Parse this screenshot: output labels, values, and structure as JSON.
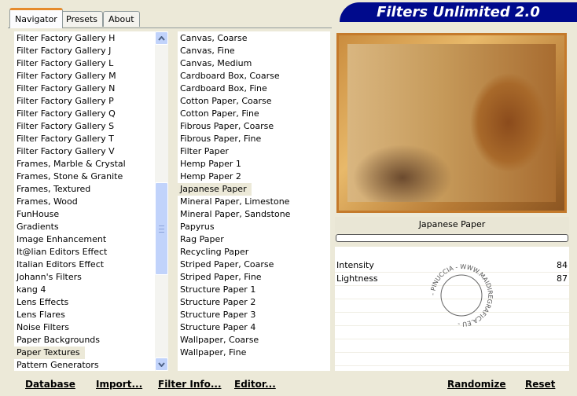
{
  "tabs": [
    "Navigator",
    "Presets",
    "About"
  ],
  "app_title": "Filters Unlimited 2.0",
  "categories": [
    "Filter Factory Gallery H",
    "Filter Factory Gallery J",
    "Filter Factory Gallery L",
    "Filter Factory Gallery M",
    "Filter Factory Gallery N",
    "Filter Factory Gallery P",
    "Filter Factory Gallery Q",
    "Filter Factory Gallery S",
    "Filter Factory Gallery T",
    "Filter Factory Gallery V",
    "Frames, Marble & Crystal",
    "Frames, Stone & Granite",
    "Frames, Textured",
    "Frames, Wood",
    "FunHouse",
    "Gradients",
    "Image Enhancement",
    "It@lian Editors Effect",
    "Italian Editors Effect",
    "Johann's Filters",
    "kang 4",
    "Lens Effects",
    "Lens Flares",
    "Noise Filters",
    "Paper Backgrounds",
    "Paper Textures",
    "Pattern Generators"
  ],
  "selected_category": "Paper Textures",
  "filters": [
    "Canvas, Coarse",
    "Canvas, Fine",
    "Canvas, Medium",
    "Cardboard Box, Coarse",
    "Cardboard Box, Fine",
    "Cotton Paper, Coarse",
    "Cotton Paper, Fine",
    "Fibrous Paper, Coarse",
    "Fibrous Paper, Fine",
    "Filter Paper",
    "Hemp Paper 1",
    "Hemp Paper 2",
    "Japanese Paper",
    "Mineral Paper, Limestone",
    "Mineral Paper, Sandstone",
    "Papyrus",
    "Rag Paper",
    "Recycling Paper",
    "Striped Paper, Coarse",
    "Striped Paper, Fine",
    "Structure Paper 1",
    "Structure Paper 2",
    "Structure Paper 3",
    "Structure Paper 4",
    "Wallpaper, Coarse",
    "Wallpaper, Fine"
  ],
  "selected_filter": "Japanese Paper",
  "current_filter_label": "Japanese Paper",
  "params": [
    {
      "label": "Intensity",
      "value": "84"
    },
    {
      "label": "Lightness",
      "value": "87"
    }
  ],
  "watermark": "- PINUCCIA - WWW.MAIDIREGRAFICA.EU -",
  "buttons": {
    "database": "Database",
    "import": "Import...",
    "filter_info": "Filter Info...",
    "editor": "Editor...",
    "randomize": "Randomize",
    "reset": "Reset"
  },
  "colors": {
    "banner": "#000a8c",
    "background": "#ece9d8",
    "scroll_accent": "#c1d3fb"
  }
}
